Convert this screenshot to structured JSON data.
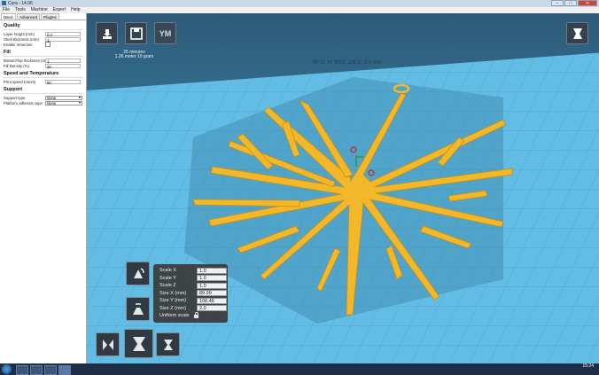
{
  "window": {
    "title": "Cura - 14.06",
    "min": "–",
    "max": "□",
    "close": "✕"
  },
  "menu": [
    "File",
    "Tools",
    "Machine",
    "Expert",
    "Help"
  ],
  "tabs": [
    "Basic",
    "Advanced",
    "Plugins"
  ],
  "sidebar": {
    "quality": {
      "title": "Quality",
      "layer_height_label": "Layer height (mm)",
      "layer_height": "0.2",
      "shell_label": "Shell thickness (mm)",
      "shell": "1",
      "retraction_label": "Enable retraction"
    },
    "fill": {
      "title": "Fill",
      "bottom_top_label": "Bottom/Top thickness (mm)",
      "bottom_top": "1",
      "density_label": "Fill Density (%)",
      "density": "20"
    },
    "speed": {
      "title": "Speed and Temperature",
      "print_speed_label": "Print speed (mm/s)",
      "print_speed": "50"
    },
    "support": {
      "title": "Support",
      "support_type_label": "Support type",
      "support_type": "None",
      "adhesion_label": "Platform adhesion type",
      "adhesion": "None"
    }
  },
  "toolbar": {
    "load_icon": "load-model-icon",
    "save_icon": "save-icon",
    "ym_label": "YM"
  },
  "print_estimate": {
    "time": "25 minutes",
    "material": "1.26 meter 10 gram"
  },
  "dimensions": "W: D: H: 90.0, 106.5, 2.0 mm",
  "scale_panel": {
    "scale_x_label": "Scale X",
    "scale_x": "1.0",
    "scale_y_label": "Scale Y",
    "scale_y": "1.0",
    "scale_z_label": "Scale Z",
    "scale_z": "1.0",
    "size_x_label": "Size X (mm)",
    "size_x": "89.99",
    "size_y_label": "Size Y (mm)",
    "size_y": "106.45",
    "size_z_label": "Size Z (mm)",
    "size_z": "2.0",
    "uniform_label": "Uniform scale"
  },
  "clock": {
    "time": "15:24"
  },
  "colors": {
    "model": "#f2b82a",
    "platform": "#5fb8e0",
    "panel": "#3d3d3d"
  }
}
